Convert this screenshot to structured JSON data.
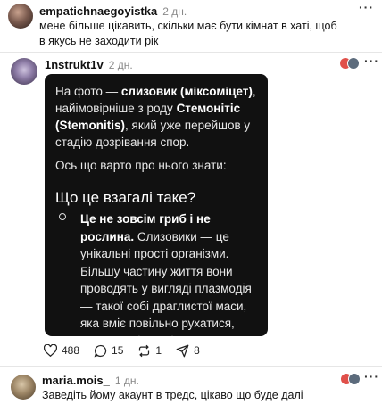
{
  "post1": {
    "username": "empatichnaegoyistka",
    "time": "2 дн.",
    "text": "мене більше цікавить, скільки має бути кімнат в хаті, щоб в якусь не заходити рік"
  },
  "post2": {
    "username": "1nstrukt1v",
    "time": "2 дн.",
    "card": {
      "p1_a": "На фото — ",
      "p1_b": "слизовик (міксоміцет)",
      "p1_c": ", найімовірніше з роду ",
      "p1_d": "Стемонітіс (Stemonitis)",
      "p1_e": ", який уже перейшов у стадію дозрівання спор.",
      "p2": "Ось що варто про нього знати:",
      "heading": "Що це взагалі таке?",
      "li_bold": "Це не зовсім гриб і не рослина.",
      "li_text": " Слизовики — це унікальні прості організми. Більшу частину життя вони проводять у вигляді плазмодія — такої собі драглистої маси, яка вміє повільно рухатися, шукаючи бактерії та залишки деревини для живлення."
    },
    "actions": {
      "likes": "488",
      "comments": "15",
      "reposts": "1",
      "shares": "8"
    }
  },
  "post3": {
    "username": "maria.mois_",
    "time": "1 дн.",
    "text": "Заведіть йому акаунт в тредс, цікаво що буде далі"
  },
  "colors": {
    "card_bg": "#111111",
    "divider": "#e6e6e6"
  }
}
